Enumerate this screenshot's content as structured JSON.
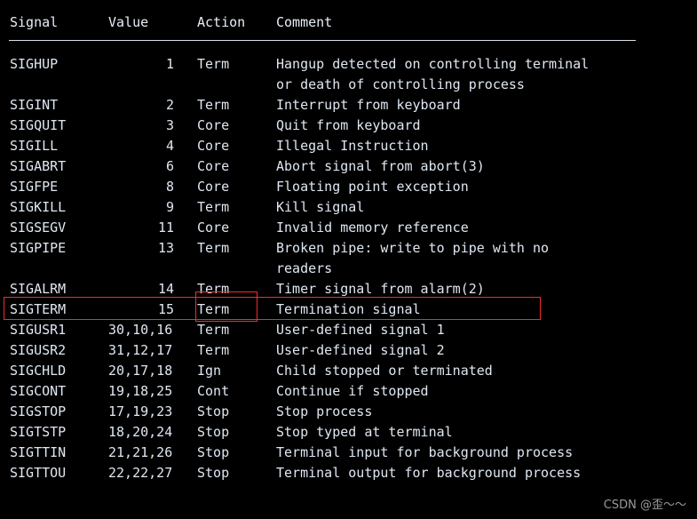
{
  "terminal": {
    "background_color": "#000000",
    "text_color": "#dfe7f2",
    "highlight_color": "#f42b2b"
  },
  "table": {
    "headers": {
      "signal": "Signal",
      "value": "Value",
      "action": "Action",
      "comment": "Comment"
    },
    "rows": [
      {
        "signal": "SIGHUP",
        "value": "1",
        "action": "Term",
        "comment": "Hangup detected on controlling terminal",
        "comment_cont": "or death of controlling process"
      },
      {
        "signal": "SIGINT",
        "value": "2",
        "action": "Term",
        "comment": "Interrupt from keyboard"
      },
      {
        "signal": "SIGQUIT",
        "value": "3",
        "action": "Core",
        "comment": "Quit from keyboard"
      },
      {
        "signal": "SIGILL",
        "value": "4",
        "action": "Core",
        "comment": "Illegal Instruction"
      },
      {
        "signal": "SIGABRT",
        "value": "6",
        "action": "Core",
        "comment": "Abort signal from abort(3)"
      },
      {
        "signal": "SIGFPE",
        "value": "8",
        "action": "Core",
        "comment": "Floating point exception"
      },
      {
        "signal": "SIGKILL",
        "value": "9",
        "action": "Term",
        "comment": "Kill signal"
      },
      {
        "signal": "SIGSEGV",
        "value": "11",
        "action": "Core",
        "comment": "Invalid memory reference"
      },
      {
        "signal": "SIGPIPE",
        "value": "13",
        "action": "Term",
        "comment": "Broken pipe: write to pipe with no",
        "comment_cont": "readers"
      },
      {
        "signal": "SIGALRM",
        "value": "14",
        "action": "Term",
        "comment": "Timer signal from alarm(2)",
        "highlighted": true
      },
      {
        "signal": "SIGTERM",
        "value": "15",
        "action": "Term",
        "comment": "Termination signal"
      },
      {
        "signal": "SIGUSR1",
        "value": "30,10,16",
        "action": "Term",
        "comment": "User-defined signal 1"
      },
      {
        "signal": "SIGUSR2",
        "value": "31,12,17",
        "action": "Term",
        "comment": "User-defined signal 2"
      },
      {
        "signal": "SIGCHLD",
        "value": "20,17,18",
        "action": "Ign",
        "comment": "Child stopped or terminated"
      },
      {
        "signal": "SIGCONT",
        "value": "19,18,25",
        "action": "Cont",
        "comment": "Continue if stopped"
      },
      {
        "signal": "SIGSTOP",
        "value": "17,19,23",
        "action": "Stop",
        "comment": "Stop process"
      },
      {
        "signal": "SIGTSTP",
        "value": "18,20,24",
        "action": "Stop",
        "comment": "Stop typed at terminal"
      },
      {
        "signal": "SIGTTIN",
        "value": "21,21,26",
        "action": "Stop",
        "comment": "Terminal input for background process"
      },
      {
        "signal": "SIGTTOU",
        "value": "22,22,27",
        "action": "Stop",
        "comment": "Terminal output for background process"
      }
    ]
  },
  "watermark": {
    "text": "CSDN @歪～～"
  }
}
